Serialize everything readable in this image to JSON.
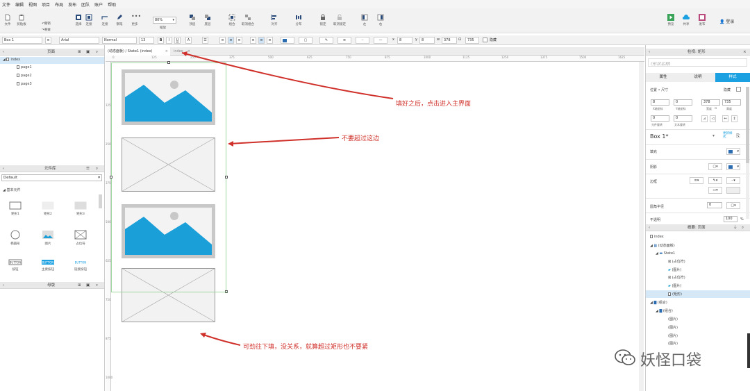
{
  "menu": [
    "文件",
    "编辑",
    "视图",
    "项目",
    "布局",
    "发布",
    "团队",
    "账户",
    "帮助"
  ],
  "toolbar": {
    "items": [
      {
        "label": "文件",
        "icon": "file-icon"
      },
      {
        "label": "剪贴板",
        "icon": "clipboard-icon"
      },
      {
        "label": "",
        "icon": "undo-icon"
      },
      {
        "label": "选择",
        "icon": "select-icon"
      },
      {
        "label": "连接",
        "icon": "connect-icon"
      },
      {
        "label": "钢笔",
        "icon": "pen-icon"
      },
      {
        "label": "更多",
        "icon": "more-icon"
      },
      {
        "label": "缩放",
        "icon": "zoom-icon"
      },
      {
        "label": "顶层",
        "icon": "top-layer-icon"
      },
      {
        "label": "底层",
        "icon": "bottom-layer-icon"
      },
      {
        "label": "组合",
        "icon": "group-icon"
      },
      {
        "label": "取消组合",
        "icon": "ungroup-icon"
      },
      {
        "label": "对齐",
        "icon": "align-icon"
      },
      {
        "label": "分布",
        "icon": "distribute-icon"
      },
      {
        "label": "锁定",
        "icon": "lock-icon"
      },
      {
        "label": "取消锁定",
        "icon": "unlock-icon"
      },
      {
        "label": "左",
        "icon": "left-icon"
      },
      {
        "label": "右",
        "icon": "right-icon"
      },
      {
        "label": "预览",
        "icon": "preview-icon"
      },
      {
        "label": "共享",
        "icon": "share-icon"
      },
      {
        "label": "发布",
        "icon": "publish-icon"
      }
    ],
    "undo": "撤销",
    "redo": "重做",
    "zoom_value": "80%",
    "login": "登录"
  },
  "format": {
    "widget_name": "Box 1",
    "font": "Arial",
    "style": "Normal",
    "size": "13",
    "x": "8",
    "y": "8",
    "w": "378",
    "h": "735",
    "hidden": "隐藏"
  },
  "pages_panel": {
    "title": "页面",
    "root": "index",
    "pages": [
      "page1",
      "page2",
      "page3"
    ]
  },
  "widgets_panel": {
    "title": "元件库",
    "library": "Default",
    "category": "基本元件",
    "widgets": [
      "矩形1",
      "矩形2",
      "矩形3",
      "椭圆形",
      "图片",
      "占位符",
      "按钮",
      "主要按钮",
      "链接按钮"
    ]
  },
  "masters_panel": {
    "title": "母版"
  },
  "tabs": [
    {
      "label": "(动态面板) / State1 (index)",
      "active": true
    },
    {
      "label": "index",
      "active": false
    }
  ],
  "ruler_top": [
    "0",
    "125",
    "250",
    "375",
    "500",
    "625",
    "750",
    "875",
    "1000",
    "1125",
    "1250",
    "1375",
    "1500",
    "1625"
  ],
  "ruler_left": [
    "125",
    "250",
    "375",
    "500",
    "625",
    "750",
    "875",
    "1000"
  ],
  "inspector": {
    "header": "检视: 矩形",
    "name_placeholder": "(形状名称)",
    "tabs": [
      "属性",
      "说明",
      "样式"
    ],
    "active_tab": "样式",
    "section": "位置 • 尺寸",
    "hidden": "隐藏",
    "x": "8",
    "y": "0",
    "w": "378",
    "h": "735",
    "x_label": "X轴坐标",
    "y_label": "Y轴坐标",
    "w_label": "宽度",
    "h_label": "高度",
    "rot1": "0",
    "rot2": "0",
    "rot_label1": "元件旋转",
    "rot_label2": "文本旋转",
    "style_name": "Box 1*",
    "style_link": "更新样式",
    "rows": [
      "填充",
      "阴影",
      "边框",
      "圆角半径",
      "不透明"
    ],
    "radius": "0",
    "opacity": "100",
    "opacity_unit": "%"
  },
  "outline": {
    "header": "概要: 页面",
    "items": [
      {
        "label": "index",
        "level": 0
      },
      {
        "label": "(动态面板)",
        "level": 1
      },
      {
        "label": "State1",
        "level": 2
      },
      {
        "label": "(占位符)",
        "level": 3
      },
      {
        "label": "(图片)",
        "level": 3
      },
      {
        "label": "(占位符)",
        "level": 3
      },
      {
        "label": "(图片)",
        "level": 3
      },
      {
        "label": "(矩形)",
        "level": 3
      },
      {
        "label": "(组合)",
        "level": 1
      },
      {
        "label": "(组合)",
        "level": 2
      },
      {
        "label": "(图片)",
        "level": 3
      },
      {
        "label": "(图片)",
        "level": 3
      },
      {
        "label": "(图片)",
        "level": 3
      },
      {
        "label": "(图片)",
        "level": 3
      }
    ]
  },
  "annotations": [
    "填好之后，点击进入主界面",
    "不要超过这边",
    "可劲往下填，没关系，就算超过矩形也不要紧"
  ],
  "watermark": "妖怪口袋",
  "colors": {
    "accent": "#1ba1e2",
    "annotation": "#d0302a",
    "image_blue": "#1a9fd8",
    "selection": "#7fd07f"
  }
}
